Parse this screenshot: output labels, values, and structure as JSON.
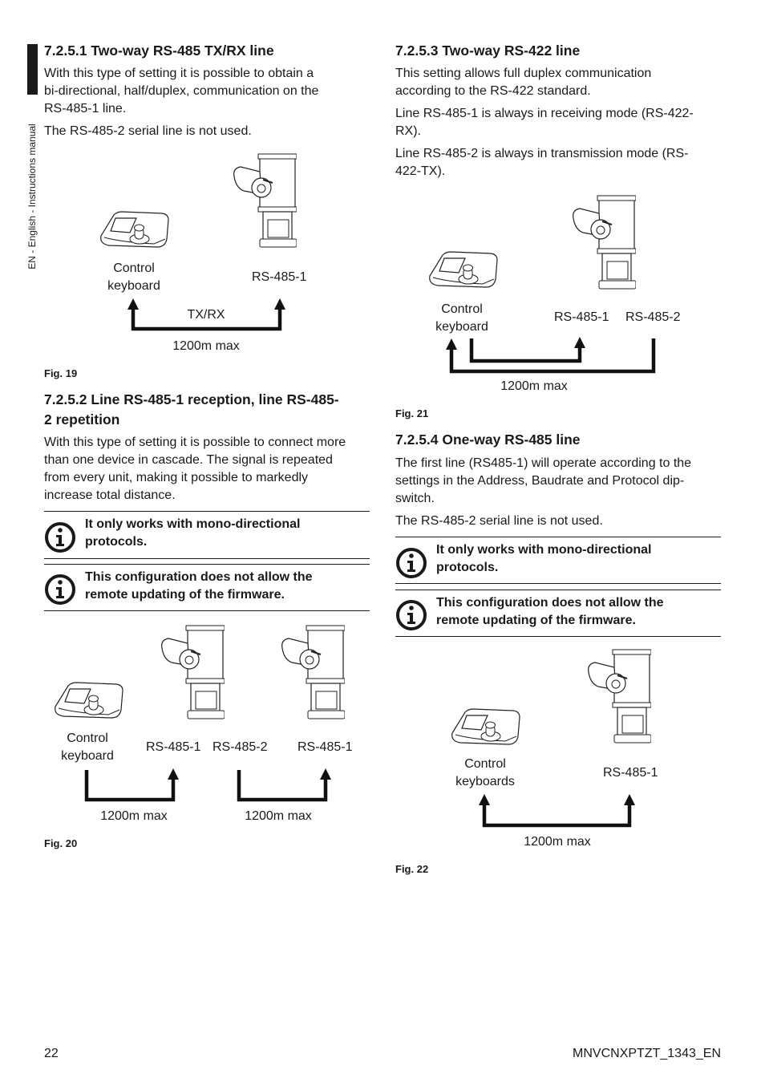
{
  "side_label": "EN - English - Instructions manual",
  "left": {
    "s1": {
      "heading": "7.2.5.1 Two-way RS-485 TX/RX line",
      "p1": [
        "With this type of setting it is possible to obtain a",
        "bi-directional, half/duplex, communication on the",
        "RS-485-1 line."
      ],
      "p2": "The RS-485-2 serial line is not used.",
      "fig": {
        "kb1": "Control",
        "kb2": "keyboard",
        "dev": "RS-485-1",
        "link": "TX/RX",
        "dist": "1200m max",
        "caption": "Fig. 19"
      }
    },
    "s2": {
      "heading": [
        "7.2.5.2 Line RS-485-1 reception, line RS-485-",
        "2 repetition"
      ],
      "p1": [
        "With this type of setting it is possible to connect more",
        "than one device in cascade. The signal is repeated",
        "from every unit, making it possible to markedly",
        "increase total distance."
      ],
      "notes": [
        [
          "It only works with mono-directional",
          "protocols."
        ],
        [
          "This configuration does not allow the",
          "remote updating of the firmware."
        ]
      ],
      "fig": {
        "kb1": "Control",
        "kb2": "keyboard",
        "d1": "RS-485-1",
        "d2": "RS-485-2",
        "d3": "RS-485-1",
        "dist1": "1200m max",
        "dist2": "1200m max",
        "caption": "Fig. 20"
      }
    }
  },
  "right": {
    "s3": {
      "heading": "7.2.5.3 Two-way RS-422 line",
      "p1": [
        "This setting allows full duplex communication",
        "according to the RS-422 standard."
      ],
      "p2": [
        "Line RS-485-1 is always in receiving mode (RS-422-",
        "RX)."
      ],
      "p3": [
        "Line RS-485-2 is always in transmission mode (RS-",
        "422-TX)."
      ],
      "fig": {
        "kb1": "Control",
        "kb2": "keyboard",
        "d1": "RS-485-1",
        "d2": "RS-485-2",
        "dist": "1200m max",
        "caption": "Fig. 21"
      }
    },
    "s4": {
      "heading": "7.2.5.4 One-way RS-485 line",
      "p1": [
        "The first line (RS485-1) will operate according to the",
        "settings in the Address, Baudrate and Protocol dip-",
        "switch."
      ],
      "p2": "The RS-485-2 serial line is not used.",
      "notes": [
        [
          "It only works with mono-directional",
          "protocols."
        ],
        [
          "This configuration does not allow the",
          "remote updating of the firmware."
        ]
      ],
      "fig": {
        "kb1": "Control",
        "kb2": "keyboards",
        "dev": "RS-485-1",
        "dist": "1200m max",
        "caption": "Fig. 22"
      }
    }
  },
  "footer": {
    "page": "22",
    "doc": "MNVCNXPTZT_1343_EN"
  }
}
